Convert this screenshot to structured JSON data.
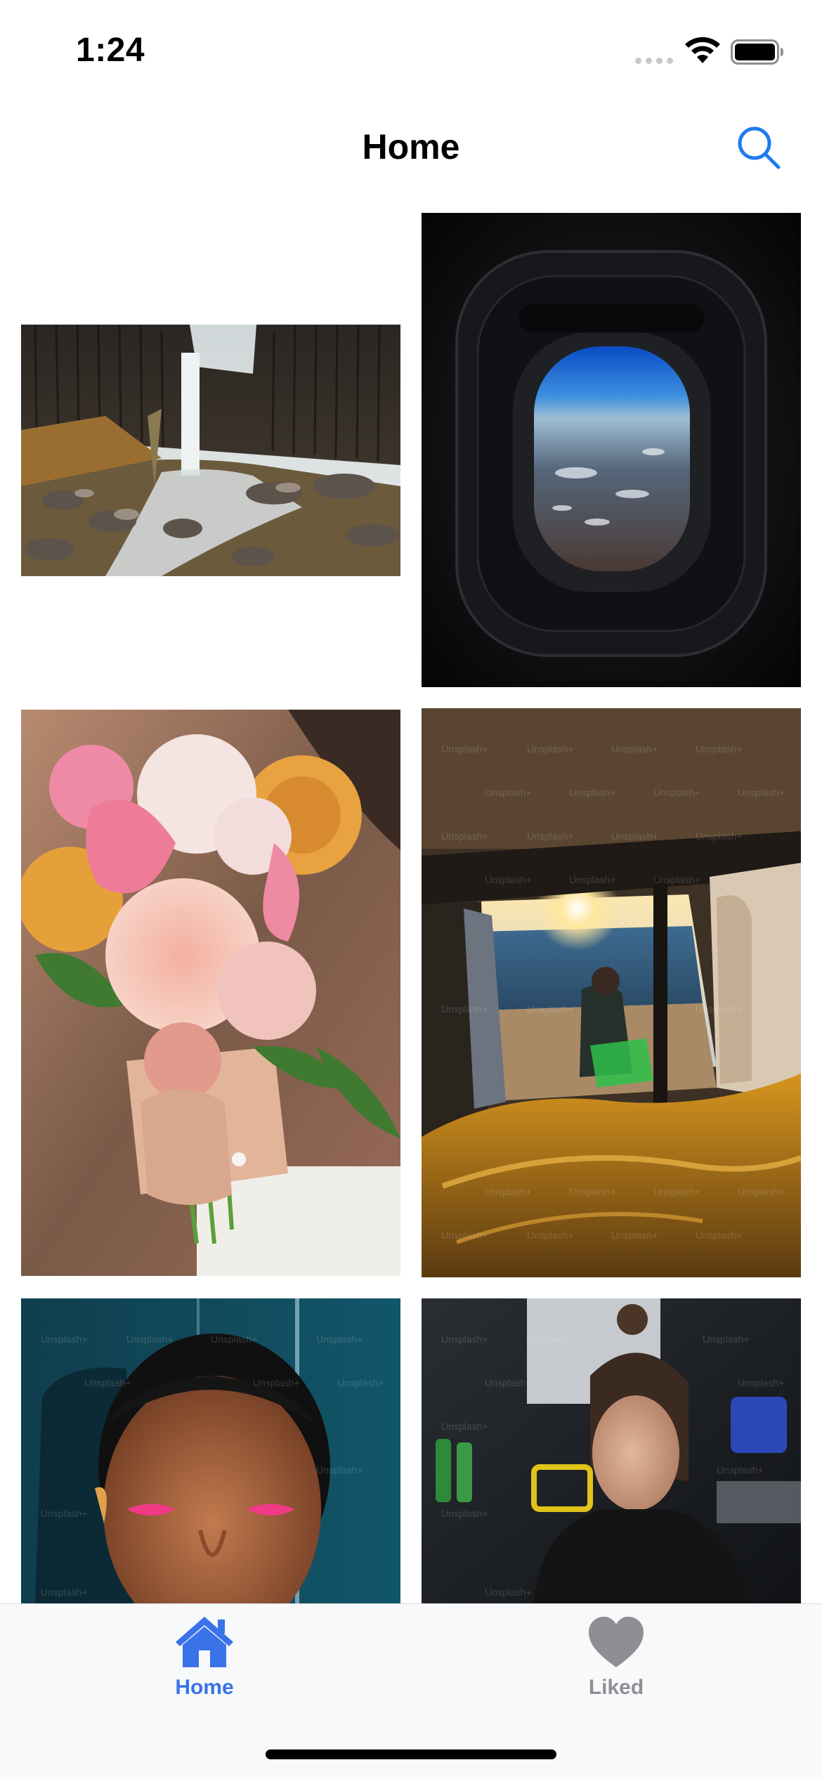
{
  "status_bar": {
    "time": "1:24",
    "icons": [
      "signal-icon",
      "wifi-icon",
      "battery-icon"
    ]
  },
  "nav": {
    "title": "Home",
    "search_icon": "search-icon"
  },
  "photos": [
    {
      "name": "photo-waterfall",
      "description_icon": "waterfall-image"
    },
    {
      "name": "photo-airplane-window",
      "description_icon": "airplane-window-image"
    },
    {
      "name": "photo-bouquet",
      "description_icon": "bouquet-image"
    },
    {
      "name": "photo-van-sunset",
      "description_icon": "van-sunset-image"
    },
    {
      "name": "photo-pink-eyeshadow",
      "description_icon": "portrait-image"
    },
    {
      "name": "photo-woman-workshop",
      "description_icon": "portrait-image"
    }
  ],
  "watermark_text": "Unsplash+",
  "tab_bar": {
    "tabs": [
      {
        "label": "Home",
        "icon": "house-icon",
        "selected": true
      },
      {
        "label": "Liked",
        "icon": "heart-icon",
        "selected": false
      }
    ]
  },
  "colors": {
    "accent": "#3a72e8",
    "search": "#1d7bf2",
    "inactive": "#8e8e93",
    "tab_bar_bg": "#f8f9fb"
  }
}
